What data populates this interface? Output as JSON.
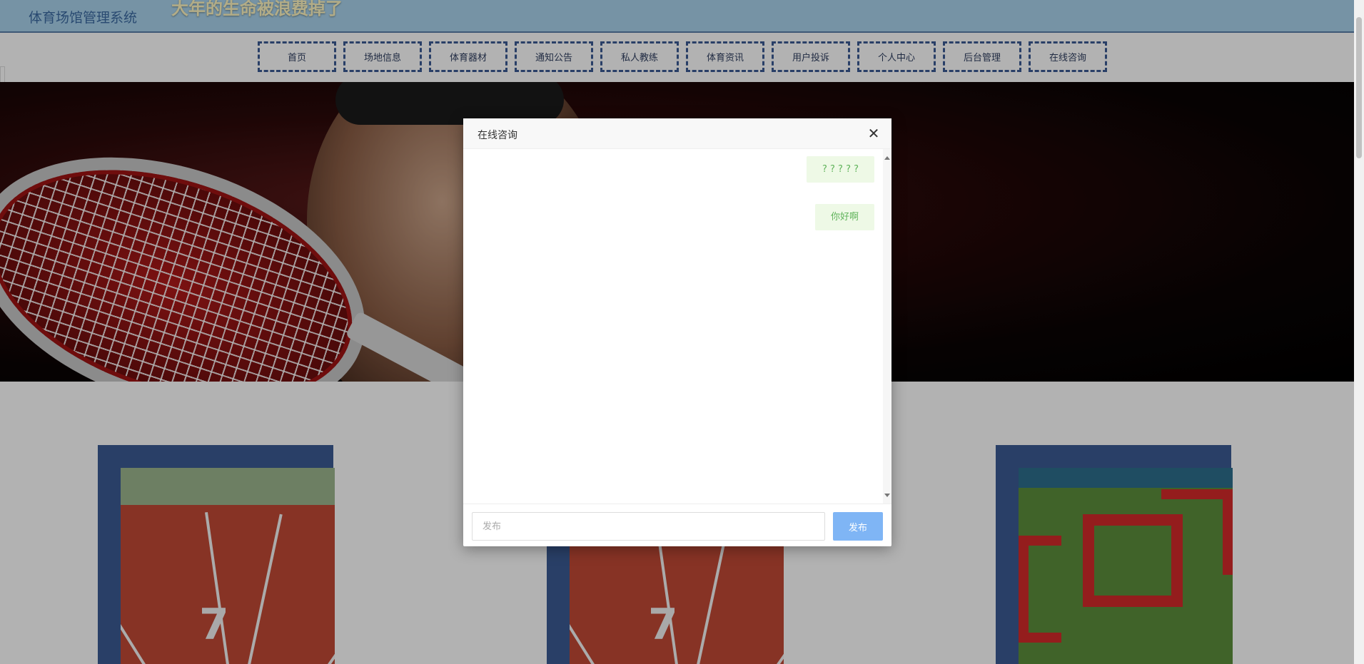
{
  "header": {
    "site_title": "体育场馆管理系统",
    "marquee_text": "大年的生命被浪费掉了"
  },
  "nav": {
    "items": [
      {
        "label": "首页"
      },
      {
        "label": "场地信息"
      },
      {
        "label": "体育器材"
      },
      {
        "label": "通知公告"
      },
      {
        "label": "私人教练"
      },
      {
        "label": "体育资讯"
      },
      {
        "label": "用户投诉"
      },
      {
        "label": "个人中心"
      },
      {
        "label": "后台管理"
      },
      {
        "label": "在线咨询"
      }
    ]
  },
  "modal": {
    "title": "在线咨询",
    "close_icon": "close-icon",
    "messages": [
      {
        "text": "? ? ? ? ?"
      },
      {
        "text": "你好啊"
      }
    ],
    "input_placeholder": "发布",
    "input_value": "",
    "send_label": "发布"
  },
  "colors": {
    "header_bg": "#a9d3ec",
    "nav_border": "#3c5b94",
    "message_bg": "#eef9e6",
    "message_text": "#5fb35a",
    "send_button": "#7fb5f5"
  }
}
